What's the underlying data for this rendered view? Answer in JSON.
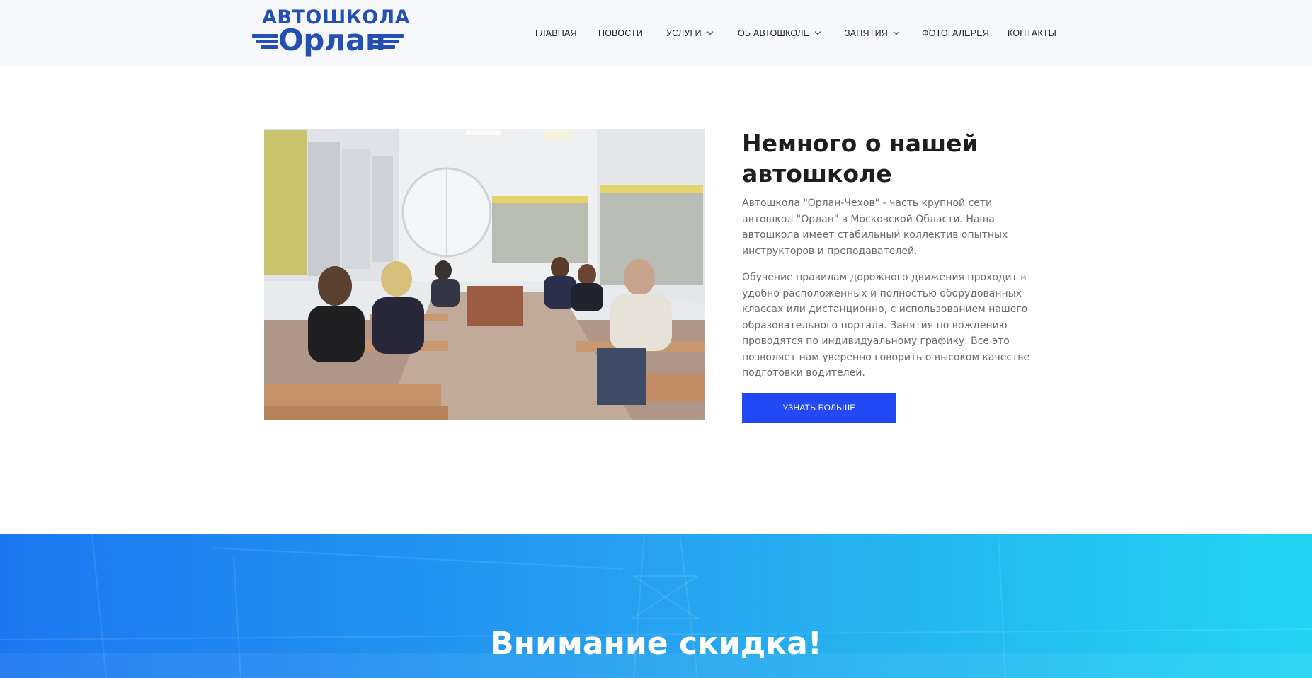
{
  "header": {
    "logo": {
      "top_text": "АВТОШКОЛА",
      "wordmark": "Орлан",
      "brand_color": "#2450b4"
    },
    "nav": [
      {
        "label": "ГЛАВНАЯ",
        "has_dropdown": false
      },
      {
        "label": "НОВОСТИ",
        "has_dropdown": false
      },
      {
        "label": "УСЛУГИ",
        "has_dropdown": true
      },
      {
        "label": "ОБ АВТОШКОЛЕ",
        "has_dropdown": true
      },
      {
        "label": "ЗАНЯТИЯ",
        "has_dropdown": true
      },
      {
        "label": "ФОТОГАЛЕРЕЯ",
        "has_dropdown": false
      },
      {
        "label": "КОНТАКТЫ",
        "has_dropdown": false
      }
    ]
  },
  "about": {
    "title": "Немного о нашей автошколе",
    "paragraph_1": "Автошкола \"Орлан-Чехов\" - часть крупной сети автошкол \"Орлан\" в Московской Области. Наша автошкола имеет стабильный коллектив опытных инструкторов и преподавателей.",
    "paragraph_2": "Обучение правилам дорожного движения проходит в удобно расположенных и полностью оборудованных классах или дистанционно, с использованием нашего образовательного портала. Занятия по вождению проводятся по индивидуальному графику. Все это позволяет нам уверенно говорить о высоком качестве подготовки водителей.",
    "button_label": "УЗНАТЬ БОЛЬШЕ",
    "button_color": "#2349f7"
  },
  "banner": {
    "title": "Внимание скидка!",
    "gradient_start": "#1b78f2",
    "gradient_end": "#22d5f2"
  }
}
